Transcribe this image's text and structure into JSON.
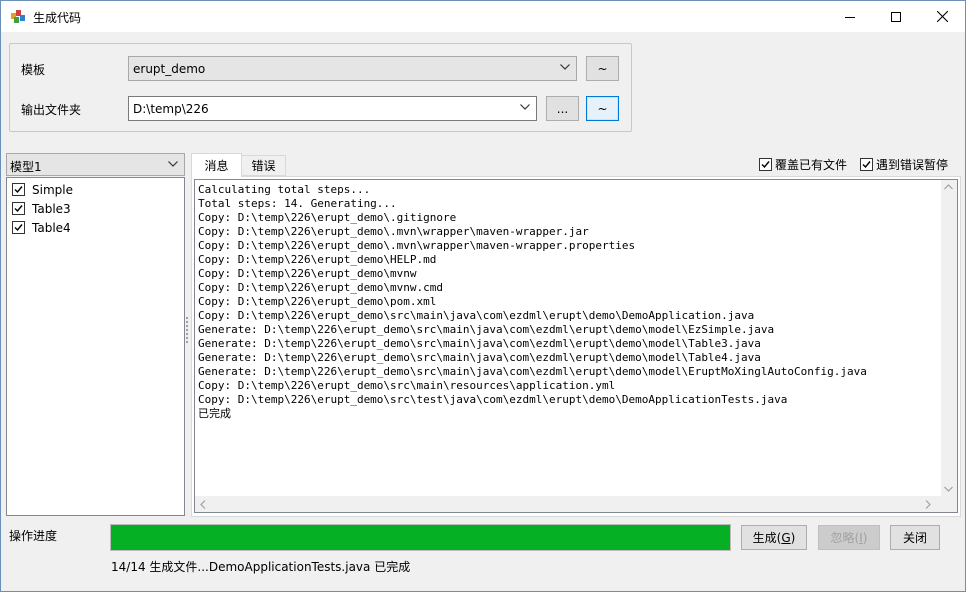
{
  "window": {
    "title": "生成代码"
  },
  "settings": {
    "template_label": "模板",
    "template_value": "erupt_demo",
    "template_btn": "~",
    "output_label": "输出文件夹",
    "output_value": "D:\\temp\\226",
    "browse_btn": "...",
    "output_btn": "~"
  },
  "models": {
    "selected": "模型1",
    "items": [
      {
        "label": "Simple",
        "checked": true
      },
      {
        "label": "Table3",
        "checked": true
      },
      {
        "label": "Table4",
        "checked": true
      }
    ]
  },
  "tabs": {
    "messages": "消息",
    "errors": "错误"
  },
  "options": {
    "overwrite_label": "覆盖已有文件",
    "pause_on_error_label": "遇到错误暂停"
  },
  "log_lines": [
    "Calculating total steps...",
    "Total steps: 14. Generating...",
    "Copy: D:\\temp\\226\\erupt_demo\\.gitignore",
    "Copy: D:\\temp\\226\\erupt_demo\\.mvn\\wrapper\\maven-wrapper.jar",
    "Copy: D:\\temp\\226\\erupt_demo\\.mvn\\wrapper\\maven-wrapper.properties",
    "Copy: D:\\temp\\226\\erupt_demo\\HELP.md",
    "Copy: D:\\temp\\226\\erupt_demo\\mvnw",
    "Copy: D:\\temp\\226\\erupt_demo\\mvnw.cmd",
    "Copy: D:\\temp\\226\\erupt_demo\\pom.xml",
    "Copy: D:\\temp\\226\\erupt_demo\\src\\main\\java\\com\\ezdml\\erupt\\demo\\DemoApplication.java",
    "Generate: D:\\temp\\226\\erupt_demo\\src\\main\\java\\com\\ezdml\\erupt\\demo\\model\\EzSimple.java",
    "Generate: D:\\temp\\226\\erupt_demo\\src\\main\\java\\com\\ezdml\\erupt\\demo\\model\\Table3.java",
    "Generate: D:\\temp\\226\\erupt_demo\\src\\main\\java\\com\\ezdml\\erupt\\demo\\model\\Table4.java",
    "Generate: D:\\temp\\226\\erupt_demo\\src\\main\\java\\com\\ezdml\\erupt\\demo\\model\\EruptMoXinglAutoConfig.java",
    "Copy: D:\\temp\\226\\erupt_demo\\src\\main\\resources\\application.yml",
    "Copy: D:\\temp\\226\\erupt_demo\\src\\test\\java\\com\\ezdml\\erupt\\demo\\DemoApplicationTests.java",
    "已完成"
  ],
  "progress": {
    "label": "操作进度",
    "fraction": 1.0,
    "status": "14/14 生成文件...DemoApplicationTests.java 已完成"
  },
  "buttons": {
    "generate_prefix": "生成(",
    "generate_key": "G",
    "generate_suffix": ")",
    "ignore_prefix": "忽略(",
    "ignore_key": "I",
    "ignore_suffix": ")",
    "close": "关闭"
  },
  "colors": {
    "progress_fill": "#06b025",
    "focus_border": "#0078d7"
  }
}
